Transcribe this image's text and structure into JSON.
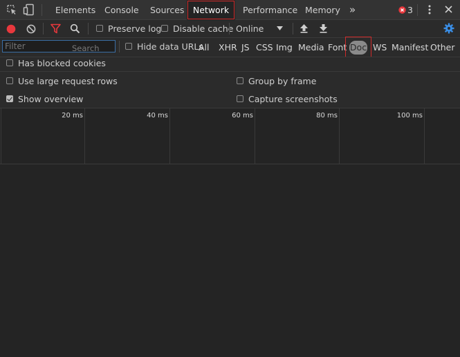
{
  "tabs": {
    "items": [
      "Elements",
      "Console",
      "Sources",
      "Network",
      "Performance",
      "Memory"
    ],
    "active": "Network",
    "more": "»",
    "error_count": "3"
  },
  "toolbar": {
    "preserve_log": "Preserve log",
    "disable_cache": "Disable cache",
    "throttle": "Online",
    "preserve_log_checked": false,
    "disable_cache_checked": false
  },
  "filter": {
    "placeholder": "Filter",
    "hint": "Search",
    "hide_data_urls": "Hide data URLs",
    "types": [
      "All",
      "XHR",
      "JS",
      "CSS",
      "Img",
      "Media",
      "Font",
      "Doc",
      "WS",
      "Manifest",
      "Other"
    ],
    "selected_type": "Doc"
  },
  "options": {
    "has_blocked_cookies": "Has blocked cookies",
    "use_large_rows": "Use large request rows",
    "group_by_frame": "Group by frame",
    "show_overview": "Show overview",
    "capture_screenshots": "Capture screenshots",
    "show_overview_checked": true
  },
  "timeline": {
    "ticks": [
      "20 ms",
      "40 ms",
      "60 ms",
      "80 ms",
      "100 ms"
    ]
  },
  "colors": {
    "accent_blue": "#3a8ee6",
    "record_red": "#e8383d",
    "filter_red": "#e8383d",
    "active_outline": "#d02a2a"
  }
}
